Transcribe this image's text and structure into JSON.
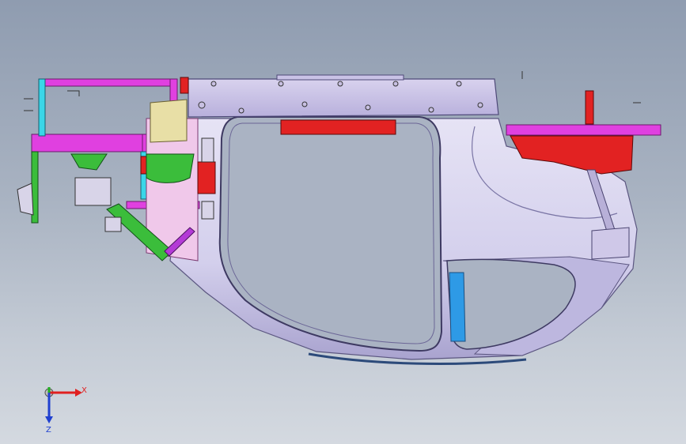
{
  "viewport": {
    "background_top": "#8f9cb0",
    "background_bottom": "#d4d9e0"
  },
  "model": {
    "parts": [
      {
        "name": "body-shell",
        "color": "#d9d6ee"
      },
      {
        "name": "top-rail",
        "color": "#cdc6e8"
      },
      {
        "name": "magenta-frame",
        "color": "#e040e0"
      },
      {
        "name": "red-bracket",
        "color": "#e22222"
      },
      {
        "name": "green-brace",
        "color": "#3bbd3b"
      },
      {
        "name": "cyan-post",
        "color": "#3ad6e8"
      },
      {
        "name": "yellow-block",
        "color": "#e8dfa6"
      },
      {
        "name": "blue-panel",
        "color": "#2e9ae6"
      },
      {
        "name": "pink-panel",
        "color": "#f0c8ea"
      }
    ]
  },
  "triad": {
    "x_label": "X",
    "z_label": "Z",
    "x_color": "#e02020",
    "y_color": "#20b020",
    "z_color": "#2040d0"
  }
}
